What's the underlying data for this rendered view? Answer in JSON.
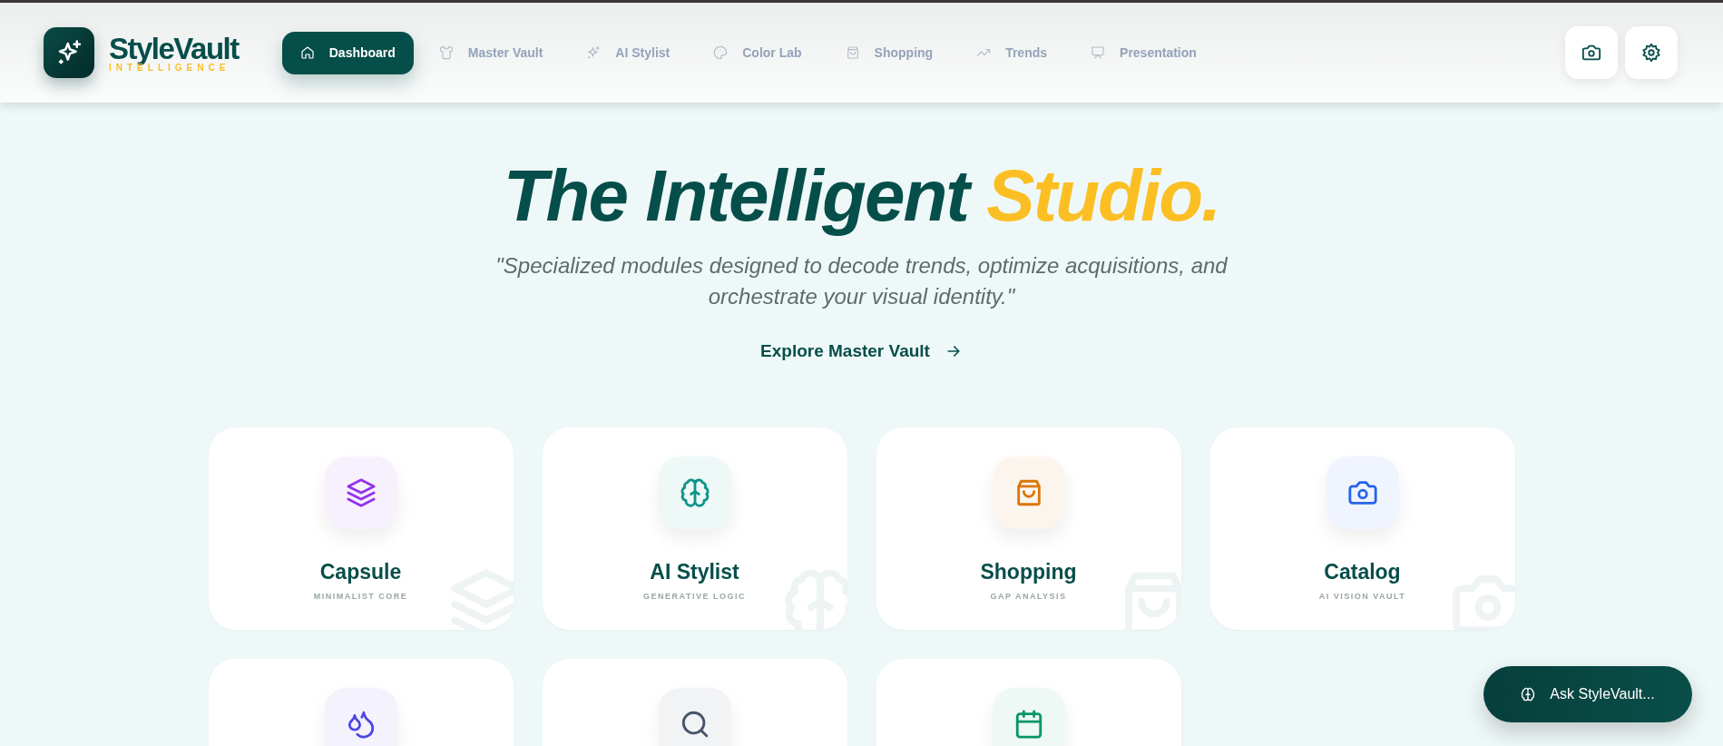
{
  "brand": {
    "name": "StyleVault",
    "tagline": "INTELLIGENCE"
  },
  "nav": [
    {
      "label": "Dashboard",
      "selected": true
    },
    {
      "label": "Master Vault",
      "selected": false
    },
    {
      "label": "AI Stylist",
      "selected": false
    },
    {
      "label": "Color Lab",
      "selected": false
    },
    {
      "label": "Shopping",
      "selected": false
    },
    {
      "label": "Trends",
      "selected": false
    },
    {
      "label": "Presentation",
      "selected": false
    }
  ],
  "hero": {
    "title": "The Intelligent",
    "title_accent": "Studio.",
    "subtitle": "\"Specialized modules designed to decode trends, optimize acquisitions, and orchestrate your visual identity.\"",
    "link": "Explore Master Vault"
  },
  "modules": [
    {
      "title": "Capsule",
      "subtitle": "MINIMALIST CORE",
      "color": "#9333ea"
    },
    {
      "title": "AI Stylist",
      "subtitle": "GENERATIVE LOGIC",
      "color": "#0d9488"
    },
    {
      "title": "Shopping",
      "subtitle": "GAP ANALYSIS",
      "color": "#d97706"
    },
    {
      "title": "Catalog",
      "subtitle": "AI VISION VAULT",
      "color": "#2563eb"
    },
    {
      "color": "#4f46e5"
    },
    {
      "color": "#475569"
    },
    {
      "color": "#059669"
    }
  ],
  "assistant_button": "Ask StyleVault..."
}
